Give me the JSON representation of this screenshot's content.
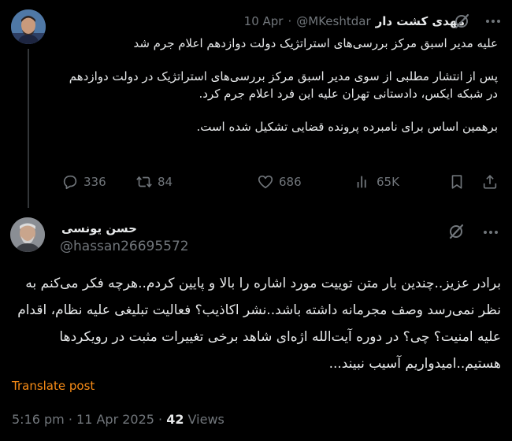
{
  "tweet1": {
    "author_name": "مهدی کشت دار",
    "handle": "@MKeshtdar",
    "separator": "·",
    "date": "10 Apr",
    "text_line1": "علیه مدیر اسبق مرکز بررسی‌های استراتژیک دولت دوازدهم اعلام جرم شد",
    "text_para2": "پس از انتشار مطلبی از سوی مدیر اسبق مرکز بررسی‌های استراتژیک در دولت دوازدهم در شبکه ایکس، دادستانی تهران علیه این فرد اعلام جرم کرد.",
    "text_para3": "برهمین اساس برای نامبرده پرونده قضایی تشکیل شده است.",
    "replies": "336",
    "retweets": "84",
    "likes": "686",
    "views": "65K"
  },
  "tweet2": {
    "author_name": "حسن یونسی",
    "handle": "@hassan26695572",
    "text": "برادر عزیز..چندین بار متن توییت مورد اشاره را بالا و پایین کردم..هرچه فکر می‌کنم به نظر نمی‌رسد وصف مجرمانه داشته باشد..نشر اکاذیب؟ فعالیت تبلیغی علیه نظام، اقدام علیه امنیت؟ چی؟ در دوره آیت‌الله اژه‌ای شاهد برخی تغییرات مثبت در رویکردها هستیم..امیدواریم آسیب نبیند...",
    "translate_label": "Translate post",
    "timestamp": "5:16 pm · 11 Apr 2025 · ",
    "views_count": "42",
    "views_label": " Views"
  },
  "icons": {
    "grok": "grok-icon",
    "more": "more-icon",
    "reply": "reply-icon",
    "retweet": "retweet-icon",
    "like": "heart-icon",
    "views": "views-icon",
    "bookmark": "bookmark-icon",
    "share": "share-icon"
  },
  "colors": {
    "background": "#000000",
    "text": "#e7e9ea",
    "muted": "#71767b",
    "link": "#f88c16",
    "divider": "#333639"
  }
}
